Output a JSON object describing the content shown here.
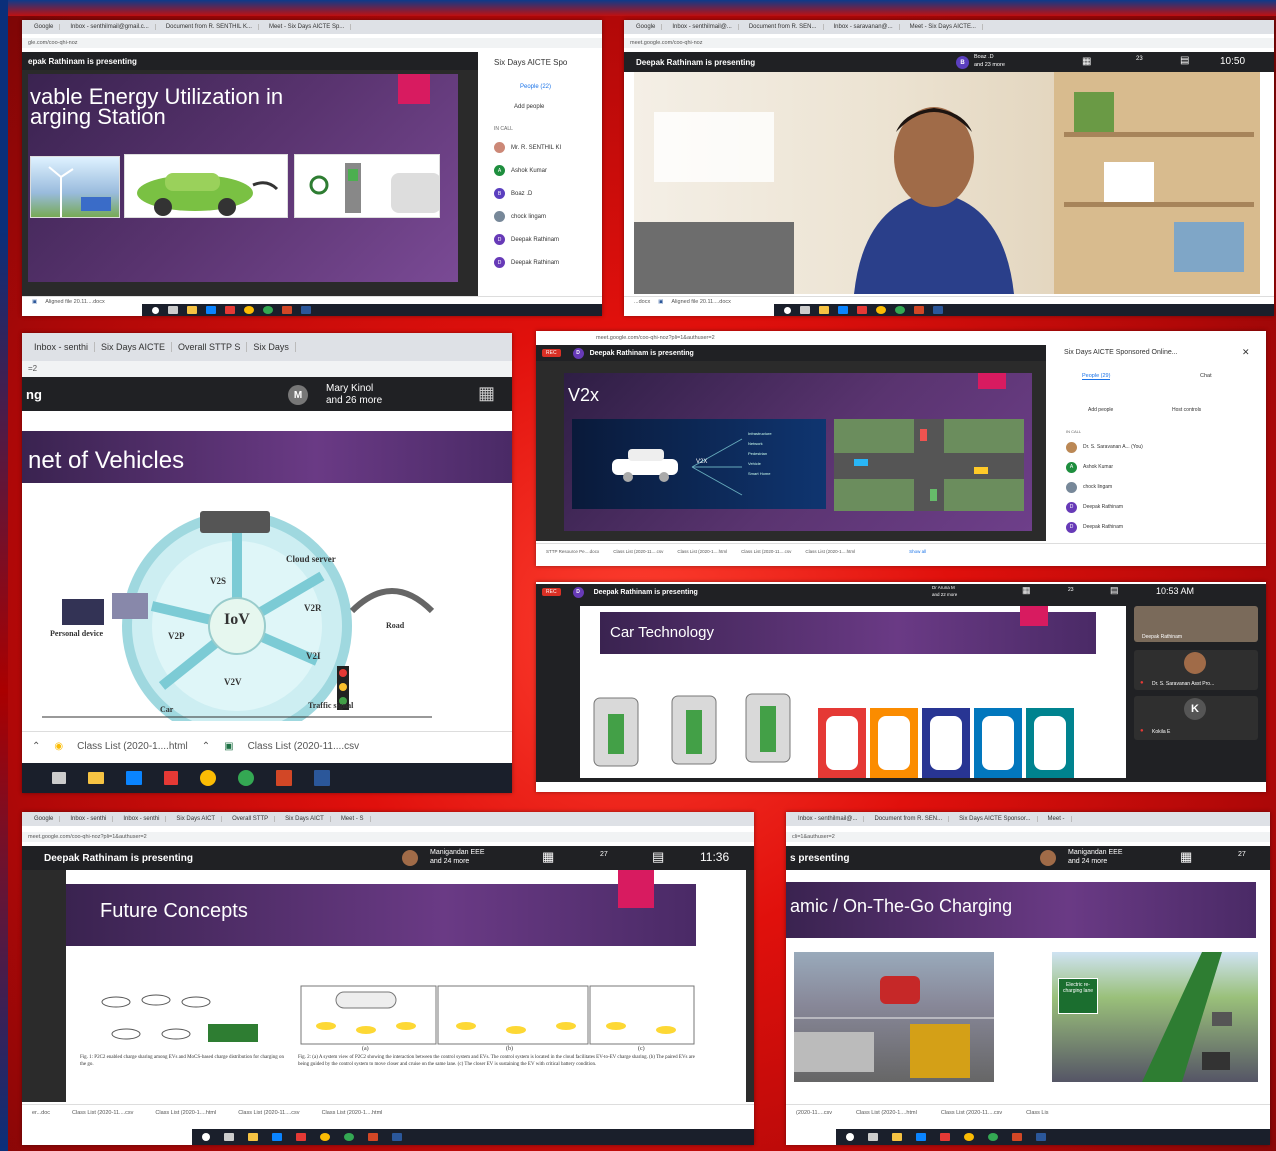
{
  "p1": {
    "tabs": [
      "Google",
      "Inbox - senthilmail@gmail.c...",
      "Document from R. SENTHIL K...",
      "Meet - Six Days AICTE Sp..."
    ],
    "url": "gle.com/coo-qhi-noz",
    "presenting": "epak Rathinam is presenting",
    "side_title": "Six Days AICTE Spo",
    "people_tab": "People (22)",
    "add_people": "Add people",
    "in_call": "IN CALL",
    "participants": [
      {
        "i": "",
        "n": "Mr. R. SENTHIL KI"
      },
      {
        "i": "A",
        "n": "Ashok Kumar"
      },
      {
        "i": "B",
        "n": "Boaz .D"
      },
      {
        "i": "",
        "n": "chock lingam"
      },
      {
        "i": "D",
        "n": "Deepak Rathinam"
      },
      {
        "i": "D",
        "n": "Deepak Rathinam"
      }
    ],
    "slide_title_1": "vable Energy Utilization in",
    "slide_title_2": "arging Station",
    "download": "Aligned file 20.11....docx"
  },
  "p2": {
    "tabs": [
      "Google",
      "Inbox - senthilmail@...",
      "Document from R. SEN...",
      "Inbox - saravanan@...",
      "Meet - Six Days AICTE..."
    ],
    "url": "meet.google.com/coo-qhi-noz",
    "presenting": "Deepak Rathinam is presenting",
    "avatar": "B",
    "others_1": "Boaz .D",
    "others_2": "and 23 more",
    "count": "23",
    "time": "10:50",
    "dl_a": "...docx",
    "dl_b": "Aligned file 20.11....docx"
  },
  "p3": {
    "tabs": [
      "Inbox - senthi",
      "Six Days AICTE",
      "Overall STTP S",
      "Six Days"
    ],
    "url": "=2",
    "presenting": "ng",
    "avatar": "M",
    "others_1": "Mary Kinol",
    "others_2": "and 26 more",
    "slide_title": "net of Vehicles",
    "labels": {
      "cloud": "Cloud server",
      "v2s": "V2S",
      "v2r": "V2R",
      "v2p": "V2P",
      "v2i": "V2I",
      "v2v": "V2V",
      "iov": "IoV",
      "personal": "Personal device",
      "road": "Road",
      "car": "Car",
      "signal": "Traffic signal"
    },
    "dl_a": "Class List (2020-1....html",
    "dl_b": "Class List (2020-11....csv"
  },
  "p4": {
    "url": "meet.google.com/coo-qhi-noz?pli=1&authuser=2",
    "rec": "REC",
    "avatar": "D",
    "presenting": "Deepak Rathinam is presenting",
    "slide_title": "V2x",
    "v2x_label": "V2X",
    "v2x_items": [
      "Infrastructure",
      "Network",
      "Pedestrian",
      "Vehicle",
      "Smart Home"
    ],
    "side_title": "Six Days AICTE Sponsored Online...",
    "people_tab": "People (29)",
    "chat_tab": "Chat",
    "add_people": "Add people",
    "host_controls": "Host controls",
    "in_call": "IN CALL",
    "participants": [
      {
        "i": "",
        "n": "Dr. S. Saravanan A... (You)"
      },
      {
        "i": "A",
        "n": "Ashok Kumar"
      },
      {
        "i": "",
        "n": "chock lingam"
      },
      {
        "i": "D",
        "n": "Deepak Rathinam"
      },
      {
        "i": "D",
        "n": "Deepak Rathinam"
      }
    ],
    "downloads": [
      "STTP Resource Pe....docx",
      "Class List (2020-11....csv",
      "Class List (2020-1....html",
      "Class List (2020-11....csv",
      "Class List (2020-1....html"
    ],
    "show_all": "Show all"
  },
  "p5": {
    "rec": "REC",
    "avatar": "D",
    "presenting": "Deepak Rathinam is presenting",
    "others_1": "Dr Aruna M",
    "others_2": "and 22 more",
    "count": "23",
    "time": "10:53 AM",
    "slide_title": "Car Technology",
    "tiles": [
      {
        "n": "Deepak Rathinam"
      },
      {
        "n": "Dr. S. Saravanan Asst Pro..."
      },
      {
        "i": "K",
        "n": "Kokila E"
      }
    ]
  },
  "p6": {
    "tabs": [
      "Google",
      "Inbox - senthi",
      "Inbox - senthi",
      "Six Days AICT",
      "Overall STTP",
      "Six Days AICT",
      "Meet - S"
    ],
    "url": "meet.google.com/coo-qhi-noz?pli=1&authuser=2",
    "presenting": "Deepak Rathinam is presenting",
    "others_1": "Manigandan EEE",
    "others_2": "and 24 more",
    "count": "27",
    "time": "11:36",
    "slide_title": "Future Concepts",
    "fig1": "Fig. 1: P2C2 enabled charge sharing among EVs and MoCS-based charge distribution for charging on the go.",
    "fig2": "Fig. 2: (a) A system view of P2C2 showing the interaction between the control system and EVs. The control system is located in the cloud facilitates EV-to-EV charge sharing. (b) The paired EVs are being guided by the control system to move closer and cruise on the same lane. (c) The closer EV is sustaining the EV with critical battery condition.",
    "sub": [
      "(a)",
      "(b)",
      "(c)"
    ],
    "downloads": [
      "er...doc",
      "Class List (2020-11....csv",
      "Class List (2020-1....html",
      "Class List (2020-11....csv",
      "Class List (2020-1....html"
    ]
  },
  "p7": {
    "tabs": [
      "Inbox - senthilmail@...",
      "Document from R. SEN...",
      "Six Days AICTE Sponsor...",
      "Meet -"
    ],
    "url": "cli=1&authuser=2",
    "presenting": "s presenting",
    "others_1": "Manigandan EEE",
    "others_2": "and 24 more",
    "count": "27",
    "slide_title": "amic / On-The-Go Charging",
    "sign": "Electric re-charging lane",
    "downloads": [
      "(2020-11....csv",
      "Class List (2020-1....html",
      "Class List (2020-11....csv",
      "Class Lis"
    ]
  },
  "colors": {
    "bg_red": "#e0100c",
    "slide_purple": "#5a3470",
    "pink_accent": "#d81b60",
    "meet_dark": "#202124"
  }
}
